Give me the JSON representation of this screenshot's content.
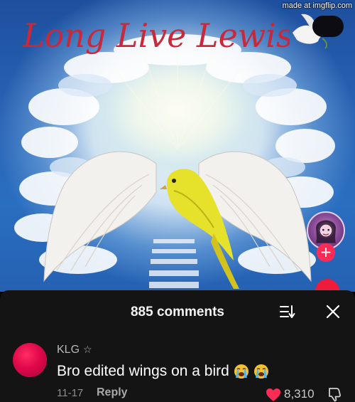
{
  "video": {
    "overlay_title": "Long Live Lewis",
    "watermark": "made at imgflip.com",
    "follow_symbol": "+"
  },
  "comments_panel": {
    "title": "885 comments",
    "icons": [
      "sort-icon",
      "close-icon"
    ]
  },
  "comment": {
    "username": "KLG",
    "badge_symbol": "☆",
    "text": "Bro edited wings on a bird",
    "emoji": [
      "loudly-crying-face",
      "loudly-crying-face"
    ],
    "date": "11-17",
    "reply_label": "Reply",
    "like_count": "8,310"
  },
  "colors": {
    "accent_red": "#fe2c55",
    "script_red": "#c8283a",
    "panel_bg": "#141414",
    "sky_blue": "#2a64b5"
  }
}
